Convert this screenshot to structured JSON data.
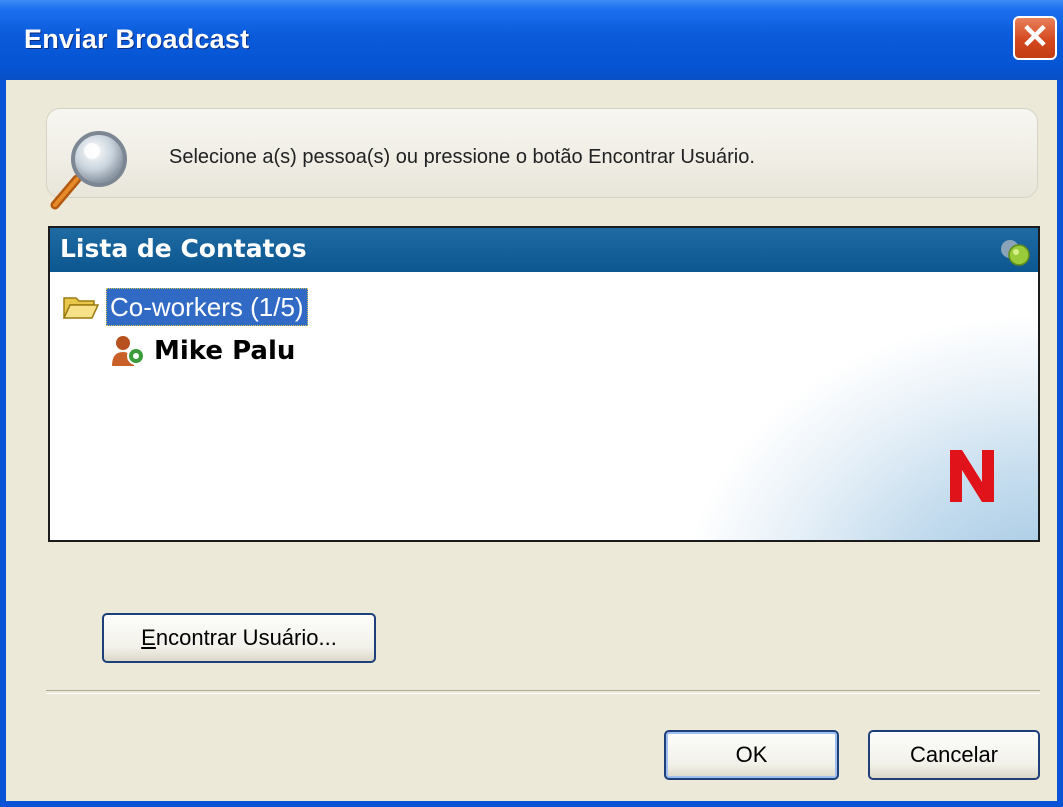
{
  "window": {
    "title": "Enviar Broadcast"
  },
  "banner": {
    "instruction": "Selecione a(s) pessoa(s) ou pressione o botão Encontrar Usuário."
  },
  "contacts": {
    "title": "Lista de Contatos",
    "groups": [
      {
        "label": "Co-workers (1/5)",
        "contacts": [
          {
            "name": "Mike Palu",
            "status": "online"
          }
        ]
      }
    ]
  },
  "buttons": {
    "find_user": "Encontrar Usuário...",
    "ok": "OK",
    "cancel": "Cancelar"
  },
  "colors": {
    "titlebar": "#0a5ad9",
    "selection": "#316ac5",
    "list_header": "#0c5790",
    "novell_red": "#e0121a"
  }
}
